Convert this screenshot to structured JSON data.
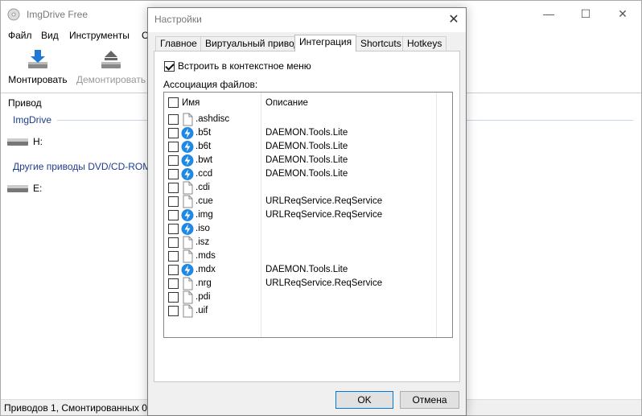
{
  "main": {
    "title": "ImgDrive Free",
    "menu": [
      "Файл",
      "Вид",
      "Инструменты",
      "С"
    ],
    "toolbar": {
      "mount": "Монтировать",
      "unmount": "Демонтировать"
    },
    "column_header": "Привод",
    "groups": [
      {
        "title": "ImgDrive",
        "drives": [
          "H:"
        ]
      },
      {
        "title": "Другие приводы DVD/CD-ROM",
        "drives": [
          "E:"
        ]
      }
    ],
    "status": "Приводов 1, Смонтированных 0"
  },
  "dialog": {
    "title": "Настройки",
    "tabs": [
      "Главное",
      "Виртуальный привод",
      "Интеграция",
      "Shortcuts",
      "Hotkeys"
    ],
    "active_tab": "Интеграция",
    "context_menu_label": "Встроить в контекстное меню",
    "context_menu_checked": true,
    "assoc_label": "Ассоциация файлов:",
    "list_headers": {
      "name": "Имя",
      "description": "Описание"
    },
    "files": [
      {
        "name": ".ashdisc",
        "desc": "",
        "icon": "blank-file-icon"
      },
      {
        "name": ".b5t",
        "desc": "DAEMON.Tools.Lite",
        "icon": "daemon-tools-icon"
      },
      {
        "name": ".b6t",
        "desc": "DAEMON.Tools.Lite",
        "icon": "daemon-tools-icon"
      },
      {
        "name": ".bwt",
        "desc": "DAEMON.Tools.Lite",
        "icon": "daemon-tools-icon"
      },
      {
        "name": ".ccd",
        "desc": "DAEMON.Tools.Lite",
        "icon": "daemon-tools-icon"
      },
      {
        "name": ".cdi",
        "desc": "",
        "icon": "blank-file-icon"
      },
      {
        "name": ".cue",
        "desc": "URLReqService.ReqService",
        "icon": "blank-file-icon"
      },
      {
        "name": ".img",
        "desc": "URLReqService.ReqService",
        "icon": "daemon-tools-icon"
      },
      {
        "name": ".iso",
        "desc": "",
        "icon": "daemon-tools-icon"
      },
      {
        "name": ".isz",
        "desc": "",
        "icon": "blank-file-icon"
      },
      {
        "name": ".mds",
        "desc": "",
        "icon": "blank-file-icon"
      },
      {
        "name": ".mdx",
        "desc": "DAEMON.Tools.Lite",
        "icon": "daemon-tools-icon"
      },
      {
        "name": ".nrg",
        "desc": "URLReqService.ReqService",
        "icon": "blank-file-icon"
      },
      {
        "name": ".pdi",
        "desc": "",
        "icon": "blank-file-icon"
      },
      {
        "name": ".uif",
        "desc": "",
        "icon": "blank-file-icon"
      }
    ],
    "ok": "OK",
    "cancel": "Отмена"
  },
  "colors": {
    "accent": "#0078d7",
    "group_title": "#1d3d8f",
    "daemon_icon": "#1e88e5"
  }
}
